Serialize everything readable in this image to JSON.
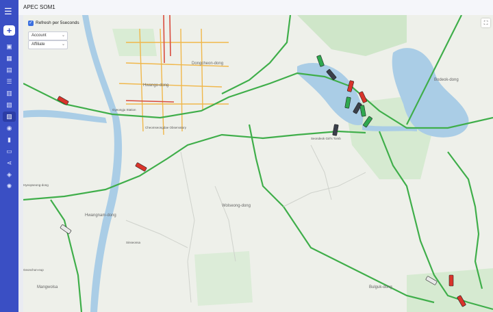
{
  "app": {
    "title": "APEC SOM1"
  },
  "sidebar": {
    "menu_icon": "hamburger-icon",
    "add_icon": "plus-icon",
    "items": [
      {
        "icon": "briefcase-icon",
        "glyph": "▣"
      },
      {
        "icon": "grid-icon",
        "glyph": "▦"
      },
      {
        "icon": "image-icon",
        "glyph": "▤"
      },
      {
        "icon": "list-icon",
        "glyph": "☰"
      },
      {
        "icon": "document-icon",
        "glyph": "▥"
      },
      {
        "icon": "calendar-icon",
        "glyph": "▧"
      },
      {
        "icon": "map-icon",
        "glyph": "▨",
        "active": true
      },
      {
        "icon": "users-icon",
        "glyph": "◉"
      },
      {
        "icon": "chart-icon",
        "glyph": "▮"
      },
      {
        "icon": "folder-icon",
        "glyph": "▭"
      },
      {
        "icon": "share-icon",
        "glyph": "⋖"
      },
      {
        "icon": "tag-icon",
        "glyph": "◈"
      },
      {
        "icon": "settings-icon",
        "glyph": "✺"
      }
    ]
  },
  "controls": {
    "refresh_label": "Refresh per 5seconds",
    "refresh_checked": true,
    "account_select": "Account",
    "affiliate_select": "Affiliate"
  },
  "map": {
    "fullscreen_icon": "fullscreen-icon",
    "places": [
      {
        "name": "Gyeongju Station"
      },
      {
        "name": "Hwango-dong"
      },
      {
        "name": "Cheomseongdae Observatory"
      },
      {
        "name": "Dongcheon-dong"
      },
      {
        "name": "Bodeok-dong"
      },
      {
        "name": "Seondeok Girl's Tomb"
      },
      {
        "name": "Wolseong-dong"
      },
      {
        "name": "Hwangnam-dong"
      },
      {
        "name": "Mangwolsa"
      },
      {
        "name": "Bulguk-dong"
      },
      {
        "name": "Hyeopseong-dong"
      },
      {
        "name": "Geonchon-eup"
      },
      {
        "name": "Sinseonsa"
      }
    ]
  },
  "colors": {
    "sidebar": "#3a4fc4",
    "river": "#aacde6",
    "road_major": "#6fd16f",
    "road_major_edge": "#3fae4a",
    "road_urban": "#f0b74a",
    "road_jam": "#d94a3d",
    "park": "#cfe6c9",
    "vehicle_red": "#d9342b",
    "vehicle_green": "#2fa84f",
    "vehicle_dark": "#3a3f4a",
    "vehicle_white": "#e8e8e8"
  },
  "vehicles": [
    {
      "color": "red"
    },
    {
      "color": "red"
    },
    {
      "color": "white"
    },
    {
      "color": "green"
    },
    {
      "color": "dark"
    },
    {
      "color": "red"
    },
    {
      "color": "green"
    },
    {
      "color": "red"
    },
    {
      "color": "dark"
    },
    {
      "color": "green"
    },
    {
      "color": "green"
    },
    {
      "color": "dark"
    },
    {
      "color": "white"
    },
    {
      "color": "red"
    },
    {
      "color": "red"
    }
  ]
}
